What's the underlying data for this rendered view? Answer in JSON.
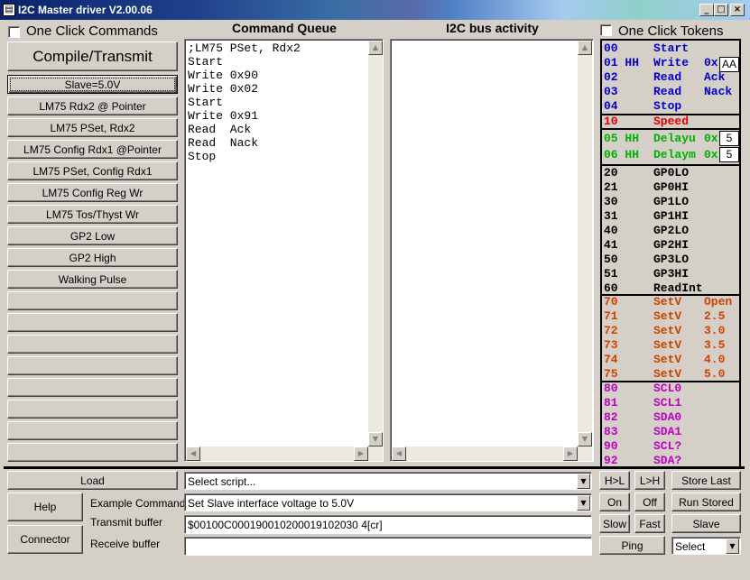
{
  "window": {
    "title": "I2C Master driver V2.00.06",
    "min": "_",
    "max": "□",
    "close": "×"
  },
  "left": {
    "one_click_commands": "One Click Commands",
    "compile_label": "Compile/Transmit",
    "buttons": [
      "Slave=5.0V",
      "LM75 Rdx2 @ Pointer",
      "LM75 PSet, Rdx2",
      "LM75 Config Rdx1 @Pointer",
      "LM75 PSet, Config Rdx1",
      "LM75 Config Reg Wr",
      "LM75 Tos/Thyst Wr",
      "GP2 Low",
      "GP2 High",
      "Walking Pulse",
      "",
      "",
      "",
      "",
      "",
      "",
      "",
      ""
    ]
  },
  "queue": {
    "header": "Command Queue",
    "text": ";LM75 PSet, Rdx2\nStart\nWrite 0x90\nWrite 0x02\nStart\nWrite 0x91\nRead  Ack\nRead  Nack\nStop"
  },
  "bus": {
    "header": "I2C bus activity",
    "text": ""
  },
  "tokens": {
    "one_click_tokens": "One Click Tokens",
    "group1": [
      {
        "code": "00",
        "name": "Start",
        "extra": ""
      },
      {
        "code": "01 HH",
        "name": "Write",
        "extra": "0x"
      },
      {
        "code": "02",
        "name": "Read",
        "extra": "Ack"
      },
      {
        "code": "03",
        "name": "Read",
        "extra": "Nack"
      },
      {
        "code": "04",
        "name": "Stop",
        "extra": ""
      }
    ],
    "write_value": "AA",
    "speed": {
      "code": "10",
      "name": "Speed"
    },
    "delays": [
      {
        "code": "05 HH",
        "name": "Delayu",
        "extra": "0x",
        "value": "5"
      },
      {
        "code": "06 HH",
        "name": "Delaym",
        "extra": "0x",
        "value": "5"
      }
    ],
    "gp": [
      {
        "code": "20",
        "name": "GP0LO"
      },
      {
        "code": "21",
        "name": "GP0HI"
      },
      {
        "code": "30",
        "name": "GP1LO"
      },
      {
        "code": "31",
        "name": "GP1HI"
      },
      {
        "code": "40",
        "name": "GP2LO"
      },
      {
        "code": "41",
        "name": "GP2HI"
      },
      {
        "code": "50",
        "name": "GP3LO"
      },
      {
        "code": "51",
        "name": "GP3HI"
      },
      {
        "code": "60",
        "name": "ReadInt"
      }
    ],
    "setv": [
      {
        "code": "70",
        "name": "SetV",
        "extra": "Open"
      },
      {
        "code": "71",
        "name": "SetV",
        "extra": "2.5"
      },
      {
        "code": "72",
        "name": "SetV",
        "extra": "3.0"
      },
      {
        "code": "73",
        "name": "SetV",
        "extra": "3.5"
      },
      {
        "code": "74",
        "name": "SetV",
        "extra": "4.0"
      },
      {
        "code": "75",
        "name": "SetV",
        "extra": "5.0"
      }
    ],
    "sig": [
      {
        "code": "80",
        "name": "SCL0"
      },
      {
        "code": "81",
        "name": "SCL1"
      },
      {
        "code": "82",
        "name": "SDA0"
      },
      {
        "code": "83",
        "name": "SDA1"
      },
      {
        "code": "90",
        "name": "SCL?"
      },
      {
        "code": "92",
        "name": "SDA?"
      }
    ]
  },
  "bottom": {
    "load": "Load",
    "help": "Help",
    "connector": "Connector",
    "script_combo": "Select script...",
    "example_label": "Example Commands",
    "example_combo": "Set Slave interface voltage to 5.0V",
    "transmit_label": "Transmit buffer",
    "transmit_value": "$00100C000190010200019102030 4[cr]",
    "receive_label": "Receive buffer",
    "receive_value": "",
    "hl": "H>L",
    "lh": "L>H",
    "store_last": "Store Last",
    "on": "On",
    "off": "Off",
    "run_stored": "Run Stored",
    "slow": "Slow",
    "fast": "Fast",
    "slave": "Slave",
    "ping": "Ping",
    "select": "Select"
  },
  "colors": {
    "blue": "#0000cc",
    "red": "#e00000",
    "green": "#00b000",
    "black": "#000000",
    "orange": "#d04000",
    "magenta": "#c000c0"
  }
}
